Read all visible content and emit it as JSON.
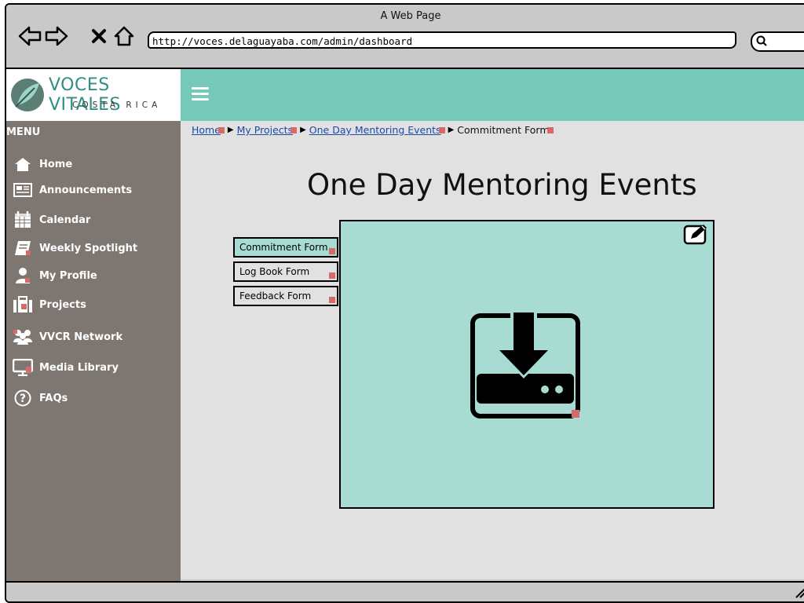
{
  "window": {
    "title": "A Web Page",
    "url": "http://voces.delaguayaba.com/admin/dashboard"
  },
  "brand": {
    "name": "VOCES VITALES",
    "sub": "COSTA RICA",
    "accent": "#76c8b8"
  },
  "menu": {
    "title": "MENU",
    "items": [
      {
        "label": "Home",
        "icon": "home-icon"
      },
      {
        "label": "Announcements",
        "icon": "announcements-icon"
      },
      {
        "label": "Calendar",
        "icon": "calendar-icon"
      },
      {
        "label": "Weekly Spotlight",
        "icon": "spotlight-icon"
      },
      {
        "label": "My Profile",
        "icon": "profile-icon"
      },
      {
        "label": "Projects",
        "icon": "projects-icon"
      },
      {
        "label": "VVCR Network",
        "icon": "network-icon"
      },
      {
        "label": "Media Library",
        "icon": "monitor-icon"
      },
      {
        "label": "FAQs",
        "icon": "question-icon"
      }
    ]
  },
  "breadcrumb": [
    "Home",
    "My Projects",
    "One Day Mentoring Events",
    "Commitment Form"
  ],
  "page": {
    "title": "One Day Mentoring Events"
  },
  "tabs": [
    "Commitment Form",
    "Log Book Form",
    "Feedback Form"
  ],
  "panel": {
    "icon": "download-icon",
    "edit_icon": "edit-icon"
  }
}
